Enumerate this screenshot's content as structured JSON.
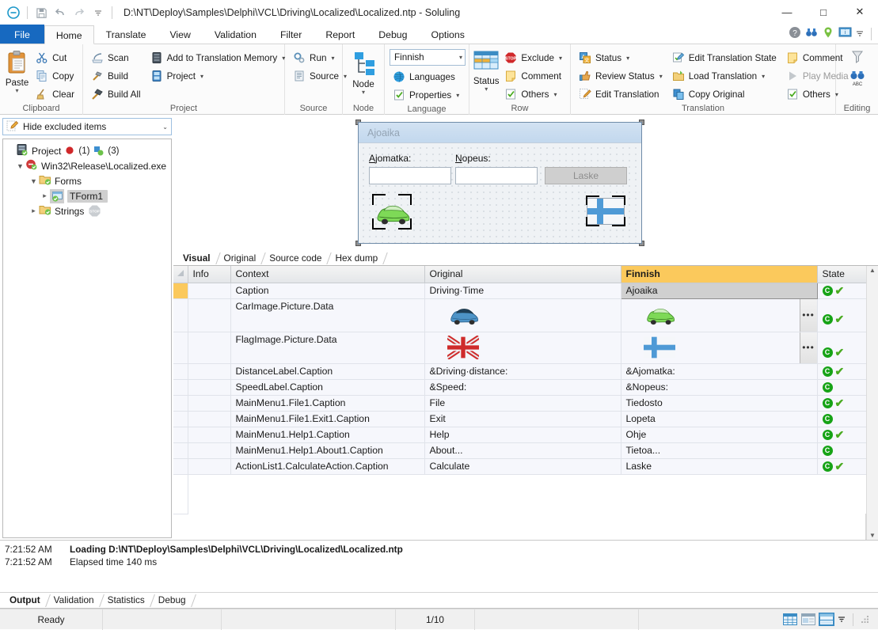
{
  "titlebar": {
    "app_icon": "soluling-logo-icon",
    "quick_access": [
      {
        "name": "save-icon",
        "label": "Save"
      },
      {
        "name": "undo-icon",
        "label": "Undo"
      },
      {
        "name": "redo-icon",
        "label": "Redo"
      },
      {
        "name": "customize-qat-icon",
        "label": "Customize Quick Access Toolbar"
      }
    ],
    "title": "D:\\NT\\Deploy\\Samples\\Delphi\\VCL\\Driving\\Localized\\Localized.ntp  -  Soluling",
    "minimize": "—",
    "maximize": "□",
    "close": "✕"
  },
  "ribbon": {
    "tabs": [
      {
        "label": "File",
        "active": false,
        "file": true
      },
      {
        "label": "Home",
        "active": true
      },
      {
        "label": "Translate",
        "active": false
      },
      {
        "label": "View",
        "active": false
      },
      {
        "label": "Validation",
        "active": false
      },
      {
        "label": "Filter",
        "active": false
      },
      {
        "label": "Report",
        "active": false
      },
      {
        "label": "Debug",
        "active": false
      },
      {
        "label": "Options",
        "active": false
      }
    ],
    "tab_right_icons": [
      "help-icon",
      "binoculars-icon",
      "location-pin-icon",
      "monitor-info-icon",
      "chevron-down-icon"
    ],
    "groups": [
      {
        "label": "Clipboard",
        "big": {
          "label": "Paste",
          "icon": "paste-icon"
        },
        "items": [
          {
            "label": "Cut",
            "icon": "cut-scissors-icon"
          },
          {
            "label": "Copy",
            "icon": "copy-icon"
          },
          {
            "label": "Clear",
            "icon": "clear-broom-icon"
          }
        ]
      },
      {
        "label": "Project",
        "col1": [
          {
            "label": "Scan",
            "icon": "scan-icon"
          },
          {
            "label": "Build",
            "icon": "build-hammer-icon"
          },
          {
            "label": "Build All",
            "icon": "build-all-hammer-icon"
          }
        ],
        "col2": [
          {
            "label": "Add to Translation Memory",
            "icon": "translation-memory-icon",
            "dropdown": true
          },
          {
            "label": "Project",
            "icon": "project-icon",
            "dropdown": true
          }
        ]
      },
      {
        "label": "Source",
        "items": [
          {
            "label": "Run",
            "icon": "run-gears-icon",
            "dropdown": true
          },
          {
            "label": "Source",
            "icon": "source-icon",
            "dropdown": true
          }
        ]
      },
      {
        "label": "Node",
        "big": {
          "label": "Node",
          "icon": "node-tree-icon"
        }
      },
      {
        "label": "Language",
        "combo_value": "Finnish",
        "items": [
          {
            "label": "Languages",
            "icon": "globe-icon"
          },
          {
            "label": "Properties",
            "icon": "properties-icon",
            "dropdown": true
          }
        ]
      },
      {
        "label": "Row",
        "big": {
          "label": "Status",
          "icon": "status-grid-icon"
        },
        "items": [
          {
            "label": "Exclude",
            "icon": "exclude-stop-icon",
            "dropdown": true
          },
          {
            "label": "Comment",
            "icon": "comment-note-icon"
          },
          {
            "label": "Others",
            "icon": "others-icon",
            "dropdown": true
          }
        ]
      },
      {
        "label": "Translation",
        "col1": [
          {
            "label": "Status",
            "icon": "translation-status-icon",
            "dropdown": true
          },
          {
            "label": "Review Status",
            "icon": "review-status-icon",
            "dropdown": true
          },
          {
            "label": "Edit Translation",
            "icon": "edit-translation-pencil-icon"
          }
        ],
        "col2": [
          {
            "label": "Edit Translation State",
            "icon": "edit-translation-state-icon"
          },
          {
            "label": "Load Translation",
            "icon": "load-translation-folder-icon",
            "dropdown": true
          },
          {
            "label": "Copy Original",
            "icon": "copy-original-icon"
          }
        ],
        "col3": [
          {
            "label": "Comment",
            "icon": "comment-note-icon"
          },
          {
            "label": "Play Media",
            "icon": "play-media-icon"
          },
          {
            "label": "Others",
            "icon": "others-icon",
            "dropdown": true
          }
        ]
      },
      {
        "label": "Editing",
        "items": [
          {
            "label": "",
            "icon": "funnel-icon"
          },
          {
            "label": "",
            "icon": "find-abc-icon"
          }
        ]
      }
    ]
  },
  "sidebar": {
    "filter": {
      "value": "Hide excluded items",
      "icon": "edit-filter-icon"
    },
    "tree": [
      {
        "label": "Project",
        "icon": "project-icon",
        "indent": 0,
        "expander": "",
        "badges": "(1)  (3)",
        "selected": false
      },
      {
        "label": "Win32\\Release\\Localized.exe",
        "icon": "exe-icon",
        "indent": 1,
        "expander": "▼",
        "selected": false
      },
      {
        "label": "Forms",
        "icon": "folder-check-icon",
        "indent": 2,
        "expander": "▼",
        "selected": false
      },
      {
        "label": "TForm1",
        "icon": "form-icon",
        "indent": 3,
        "expander": "▶",
        "selected": true
      },
      {
        "label": "Strings",
        "icon": "folder-check-icon",
        "indent": 2,
        "expander": "▶",
        "badges": "stop",
        "selected": false
      }
    ],
    "badge_red_count": "(1)",
    "badge_green_count": "(3)"
  },
  "designer": {
    "form_caption": "Ajoaika",
    "labels": [
      {
        "text": "Ajomatka:",
        "accel": "A"
      },
      {
        "text": "Nopeus:",
        "accel": "N"
      }
    ],
    "button": "Laske",
    "car_image": "green-car-icon",
    "flag_image": "finland-flag-icon",
    "tabs": [
      {
        "label": "Visual",
        "active": true
      },
      {
        "label": "Original",
        "active": false
      },
      {
        "label": "Source code",
        "active": false
      },
      {
        "label": "Hex dump",
        "active": false
      }
    ]
  },
  "grid": {
    "columns": [
      "",
      "Info",
      "Context",
      "Original",
      "Finnish",
      "State"
    ],
    "highlighted_column": "Finnish",
    "rows": [
      {
        "current": true,
        "info": "",
        "context": "Caption",
        "original": "Driving·Time",
        "target": "Ajoaika",
        "target_selected": true,
        "state": [
          "c",
          "check"
        ],
        "type": "text"
      },
      {
        "current": false,
        "info": "",
        "context": "CarImage.Picture.Data",
        "original_icon": "blue-car-icon",
        "target_icon": "green-car-icon",
        "state": [
          "c",
          "check"
        ],
        "type": "image"
      },
      {
        "current": false,
        "info": "",
        "context": "FlagImage.Picture.Data",
        "original_icon": "uk-flag-icon",
        "target_icon": "finland-flag-icon",
        "state": [
          "c",
          "check"
        ],
        "type": "image"
      },
      {
        "current": false,
        "info": "",
        "context": "DistanceLabel.Caption",
        "original": "&Driving·distance:",
        "target": "&Ajomatka:",
        "state": [
          "c",
          "check"
        ],
        "type": "text"
      },
      {
        "current": false,
        "info": "",
        "context": "SpeedLabel.Caption",
        "original": "&Speed:",
        "target": "&Nopeus:",
        "state": [
          "c"
        ],
        "type": "text"
      },
      {
        "current": false,
        "info": "",
        "context": "MainMenu1.File1.Caption",
        "original": "File",
        "target": "Tiedosto",
        "state": [
          "c",
          "check"
        ],
        "type": "text"
      },
      {
        "current": false,
        "info": "",
        "context": "MainMenu1.File1.Exit1.Caption",
        "original": "Exit",
        "target": "Lopeta",
        "state": [
          "c"
        ],
        "type": "text"
      },
      {
        "current": false,
        "info": "",
        "context": "MainMenu1.Help1.Caption",
        "original": "Help",
        "target": "Ohje",
        "state": [
          "c",
          "check"
        ],
        "type": "text"
      },
      {
        "current": false,
        "info": "",
        "context": "MainMenu1.Help1.About1.Caption",
        "original": "About...",
        "target": "Tietoa...",
        "state": [
          "c"
        ],
        "type": "text"
      },
      {
        "current": false,
        "info": "",
        "context": "ActionList1.CalculateAction.Caption",
        "original": "Calculate",
        "target": "Laske",
        "state": [
          "c",
          "check"
        ],
        "type": "text"
      }
    ],
    "ellipsis_label": "•••"
  },
  "output": {
    "lines": [
      {
        "time": "7:21:52 AM",
        "message": "Loading D:\\NT\\Deploy\\Samples\\Delphi\\VCL\\Driving\\Localized\\Localized.ntp",
        "bold": true
      },
      {
        "time": "7:21:52 AM",
        "message": "Elapsed time 140 ms",
        "bold": false
      }
    ],
    "tabs": [
      {
        "label": "Output",
        "active": true
      },
      {
        "label": "Validation",
        "active": false
      },
      {
        "label": "Statistics",
        "active": false
      },
      {
        "label": "Debug",
        "active": false
      }
    ]
  },
  "statusbar": {
    "ready": "Ready",
    "field1": "",
    "field2": "",
    "counter": "1/10",
    "field3": "",
    "view_buttons": [
      "grid-view-icon",
      "form-view-icon",
      "split-view-icon",
      "view-dropdown-icon"
    ]
  },
  "colors": {
    "accent": "#1769c0",
    "highlight_column": "#fbc95c",
    "state_green": "#16a316",
    "check_green": "#4aab21"
  }
}
